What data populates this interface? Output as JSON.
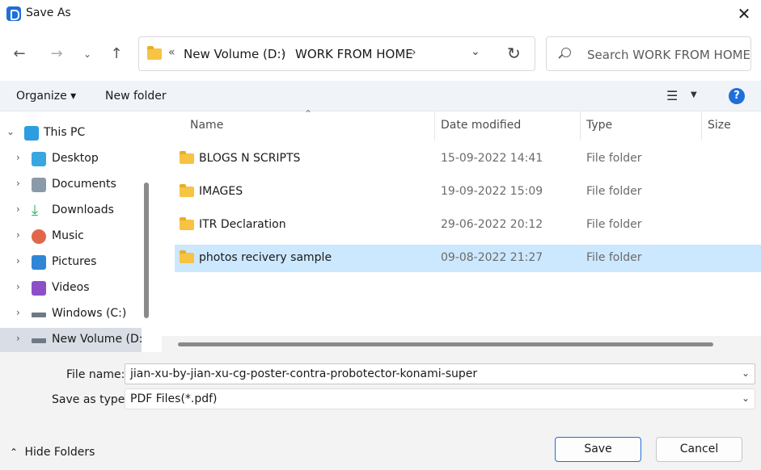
{
  "window": {
    "title": "Save As"
  },
  "address": {
    "overflow": "«",
    "segments": [
      "New Volume (D:)",
      "WORK FROM HOME"
    ]
  },
  "search": {
    "placeholder": "Search WORK FROM HOME"
  },
  "toolbar": {
    "organize_label": "Organize ▾",
    "new_folder_label": "New folder",
    "help_label": "?"
  },
  "sidebar": {
    "items": [
      {
        "label": "This PC",
        "icon": "pc-icon",
        "color": "#2b9de0"
      },
      {
        "label": "Desktop",
        "icon": "desktop-icon",
        "color": "#3aa6e0"
      },
      {
        "label": "Documents",
        "icon": "documents-icon",
        "color": "#8a9aa8"
      },
      {
        "label": "Downloads",
        "icon": "downloads-icon",
        "color": "#2aa865"
      },
      {
        "label": "Music",
        "icon": "music-icon",
        "color": "#e0674b"
      },
      {
        "label": "Pictures",
        "icon": "pictures-icon",
        "color": "#2f86d6"
      },
      {
        "label": "Videos",
        "icon": "videos-icon",
        "color": "#8d4fc8"
      },
      {
        "label": "Windows (C:)",
        "icon": "drive-c-icon",
        "color": "#6f7a85"
      },
      {
        "label": "New Volume (D:",
        "icon": "drive-d-icon",
        "color": "#6f7a85"
      }
    ]
  },
  "columns": {
    "name": "Name",
    "date": "Date modified",
    "type": "Type",
    "size": "Size"
  },
  "files": [
    {
      "name": "BLOGS N SCRIPTS",
      "date": "15-09-2022 14:41",
      "type": "File folder"
    },
    {
      "name": "IMAGES",
      "date": "19-09-2022 15:09",
      "type": "File folder"
    },
    {
      "name": "ITR Declaration",
      "date": "29-06-2022 20:12",
      "type": "File folder"
    },
    {
      "name": "photos recivery sample",
      "date": "09-08-2022 21:27",
      "type": "File folder"
    }
  ],
  "form": {
    "filename_label": "File name:",
    "filename_value": "jian-xu-by-jian-xu-cg-poster-contra-probotector-konami-super",
    "savetype_label": "Save as type:",
    "savetype_value": "PDF Files(*.pdf)"
  },
  "footer": {
    "hide_folders": "Hide Folders",
    "save": "Save",
    "cancel": "Cancel"
  }
}
